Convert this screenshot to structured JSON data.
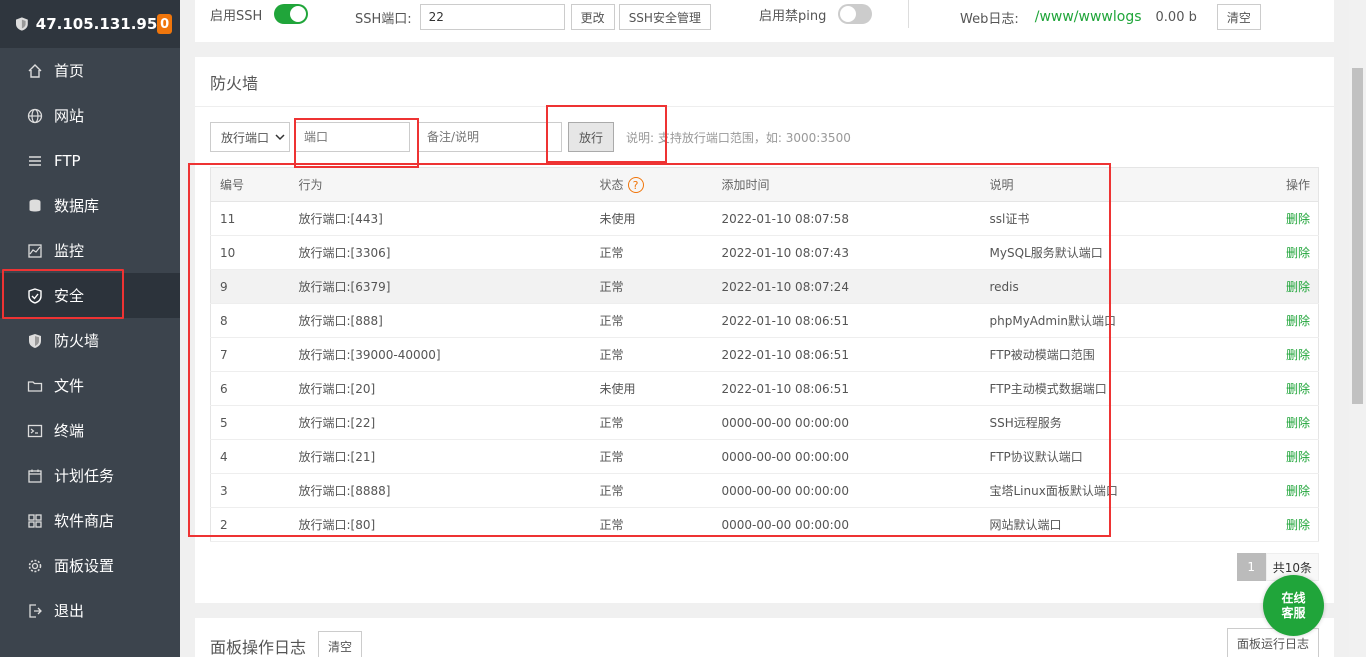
{
  "sidebar": {
    "ip": "47.105.131.95",
    "badge": "0",
    "items": [
      {
        "label": "首页",
        "icon": "home-icon"
      },
      {
        "label": "网站",
        "icon": "globe-icon"
      },
      {
        "label": "FTP",
        "icon": "ftp-icon"
      },
      {
        "label": "数据库",
        "icon": "database-icon"
      },
      {
        "label": "监控",
        "icon": "monitor-icon"
      },
      {
        "label": "安全",
        "icon": "shield-icon"
      },
      {
        "label": "防火墙",
        "icon": "firewall-icon"
      },
      {
        "label": "文件",
        "icon": "folder-icon"
      },
      {
        "label": "终端",
        "icon": "terminal-icon"
      },
      {
        "label": "计划任务",
        "icon": "calendar-icon"
      },
      {
        "label": "软件商店",
        "icon": "store-icon"
      },
      {
        "label": "面板设置",
        "icon": "gear-icon"
      },
      {
        "label": "退出",
        "icon": "logout-icon"
      }
    ]
  },
  "top": {
    "ssh_label": "启用SSH",
    "ssh_port_label": "SSH端口:",
    "ssh_port_value": "22",
    "change_btn": "更改",
    "ssh_manage_btn": "SSH安全管理",
    "ping_label": "启用禁ping",
    "weblog_label": "Web日志:",
    "weblog_path": "/www/wwwlogs",
    "weblog_size": "0.00 b",
    "clear_btn": "清空"
  },
  "firewall": {
    "title": "防火墙",
    "select_value": "放行端口",
    "port_placeholder": "端口",
    "note_placeholder": "备注/说明",
    "allow_btn": "放行",
    "hint": "说明: 支持放行端口范围，如: 3000:3500",
    "columns": [
      "编号",
      "行为",
      "状态",
      "添加时间",
      "说明",
      "操作"
    ],
    "rows": [
      {
        "id": "11",
        "action": "放行端口:[443]",
        "status": "未使用",
        "time": "2022-01-10 08:07:58",
        "note": "ssl证书",
        "op": "删除"
      },
      {
        "id": "10",
        "action": "放行端口:[3306]",
        "status": "正常",
        "time": "2022-01-10 08:07:43",
        "note": "MySQL服务默认端口",
        "op": "删除"
      },
      {
        "id": "9",
        "action": "放行端口:[6379]",
        "status": "正常",
        "time": "2022-01-10 08:07:24",
        "note": "redis",
        "op": "删除"
      },
      {
        "id": "8",
        "action": "放行端口:[888]",
        "status": "正常",
        "time": "2022-01-10 08:06:51",
        "note": "phpMyAdmin默认端口",
        "op": "删除"
      },
      {
        "id": "7",
        "action": "放行端口:[39000-40000]",
        "status": "正常",
        "time": "2022-01-10 08:06:51",
        "note": "FTP被动模端口范围",
        "op": "删除"
      },
      {
        "id": "6",
        "action": "放行端口:[20]",
        "status": "未使用",
        "time": "2022-01-10 08:06:51",
        "note": "FTP主动模式数据端口",
        "op": "删除"
      },
      {
        "id": "5",
        "action": "放行端口:[22]",
        "status": "正常",
        "time": "0000-00-00 00:00:00",
        "note": "SSH远程服务",
        "op": "删除"
      },
      {
        "id": "4",
        "action": "放行端口:[21]",
        "status": "正常",
        "time": "0000-00-00 00:00:00",
        "note": "FTP协议默认端口",
        "op": "删除"
      },
      {
        "id": "3",
        "action": "放行端口:[8888]",
        "status": "正常",
        "time": "0000-00-00 00:00:00",
        "note": "宝塔Linux面板默认端口",
        "op": "删除"
      },
      {
        "id": "2",
        "action": "放行端口:[80]",
        "status": "正常",
        "time": "0000-00-00 00:00:00",
        "note": "网站默认端口",
        "op": "删除"
      }
    ],
    "page": "1",
    "total": "共10条"
  },
  "log": {
    "title": "面板操作日志",
    "clear_btn": "清空",
    "run_log_btn": "面板运行日志"
  },
  "chat": {
    "line1": "在线",
    "line2": "客服"
  },
  "colors": {
    "sidebar_bg": "#3c444d",
    "accent_green": "#20a53a",
    "badge_orange": "#f0760c",
    "highlight_red": "#e33333"
  }
}
